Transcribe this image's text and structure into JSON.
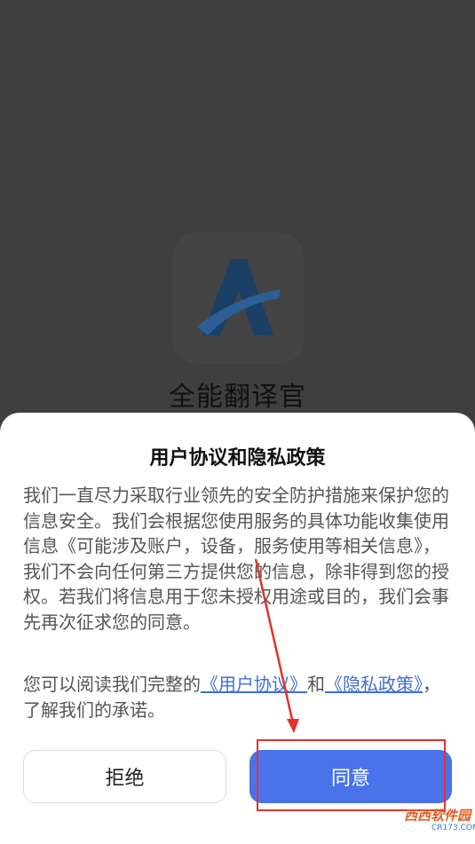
{
  "app": {
    "name": "全能翻译官"
  },
  "dialog": {
    "title": "用户协议和隐私政策",
    "body": "我们一直尽力采取行业领先的安全防护措施来保护您的信息安全。我们会根据您使用服务的具体功能收集使用信息《可能涉及账户，设备，服务使用等相关信息》， 我们不会向任何第三方提供您的信息，除非得到您的授权。若我们将信息用于您未授权用途或目的，我们会事先再次征求您的同意。",
    "read_prefix": "您可以阅读我们完整的",
    "user_agreement_link": "《用户协议》",
    "and": "和",
    "privacy_link": "《隐私政策》",
    "read_suffix": "，了解我们的承诺。",
    "reject_label": "拒绝",
    "agree_label": "同意"
  },
  "watermark": {
    "text": "西西软件园",
    "sub": "CR173.COM"
  },
  "colors": {
    "accent": "#4a73ea",
    "link": "#3f6fd6",
    "annotation": "#e0322c"
  }
}
